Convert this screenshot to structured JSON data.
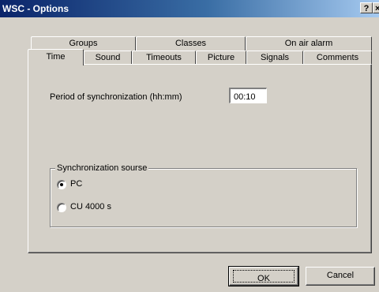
{
  "window": {
    "title": "WSC - Options",
    "help_label": "?",
    "close_label": "×"
  },
  "tabs": {
    "row_back": [
      "Groups",
      "Classes",
      "On air alarm"
    ],
    "row_front": [
      "Time",
      "Sound",
      "Timeouts",
      "Picture",
      "Signals",
      "Comments"
    ],
    "active": "Time"
  },
  "time": {
    "period_label": "Period of synchronization (hh:mm)",
    "period_value": "00:10"
  },
  "sync_source": {
    "legend": "Synchronization sourse",
    "options": [
      {
        "label": "PC",
        "selected": true
      },
      {
        "label": "CU 4000 s",
        "selected": false
      }
    ]
  },
  "buttons": {
    "ok": "OK",
    "cancel": "Cancel"
  }
}
